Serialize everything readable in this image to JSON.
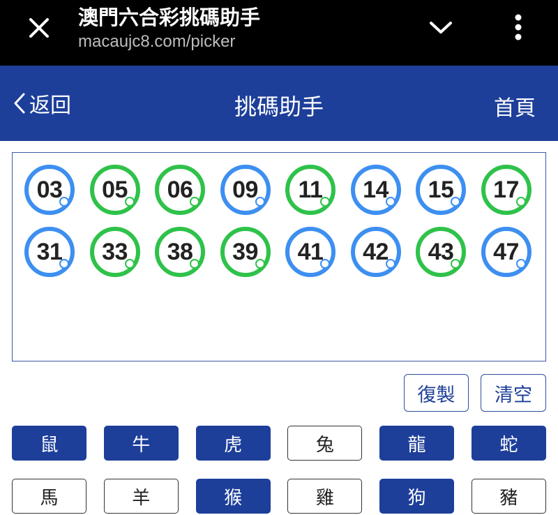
{
  "browser": {
    "title": "澳門六合彩挑碼助手",
    "url": "macaujc8.com/picker"
  },
  "header": {
    "back_label": "返回",
    "title": "挑碼助手",
    "home_label": "首頁",
    "color": "#1d3f9a"
  },
  "balls": [
    {
      "number": "03",
      "color": "blue"
    },
    {
      "number": "05",
      "color": "green"
    },
    {
      "number": "06",
      "color": "green"
    },
    {
      "number": "09",
      "color": "blue"
    },
    {
      "number": "11",
      "color": "green"
    },
    {
      "number": "14",
      "color": "blue"
    },
    {
      "number": "15",
      "color": "blue"
    },
    {
      "number": "17",
      "color": "green"
    },
    {
      "number": "31",
      "color": "blue"
    },
    {
      "number": "33",
      "color": "green"
    },
    {
      "number": "38",
      "color": "green"
    },
    {
      "number": "39",
      "color": "green"
    },
    {
      "number": "41",
      "color": "blue"
    },
    {
      "number": "42",
      "color": "blue"
    },
    {
      "number": "43",
      "color": "green"
    },
    {
      "number": "47",
      "color": "blue"
    }
  ],
  "ball_colors": {
    "blue": "#3d8ff0",
    "green": "#2fc24a"
  },
  "actions": {
    "copy_label": "復製",
    "clear_label": "清空"
  },
  "zodiac": [
    {
      "label": "鼠",
      "selected": true
    },
    {
      "label": "牛",
      "selected": true
    },
    {
      "label": "虎",
      "selected": true
    },
    {
      "label": "兔",
      "selected": false
    },
    {
      "label": "龍",
      "selected": true
    },
    {
      "label": "蛇",
      "selected": true
    },
    {
      "label": "馬",
      "selected": false
    },
    {
      "label": "羊",
      "selected": false
    },
    {
      "label": "猴",
      "selected": true
    },
    {
      "label": "雞",
      "selected": false
    },
    {
      "label": "狗",
      "selected": true
    },
    {
      "label": "豬",
      "selected": false
    }
  ],
  "icons": {
    "close": "close-icon",
    "chevron": "chevron-down-icon",
    "more": "more-vert-icon",
    "back": "chevron-left-icon"
  }
}
